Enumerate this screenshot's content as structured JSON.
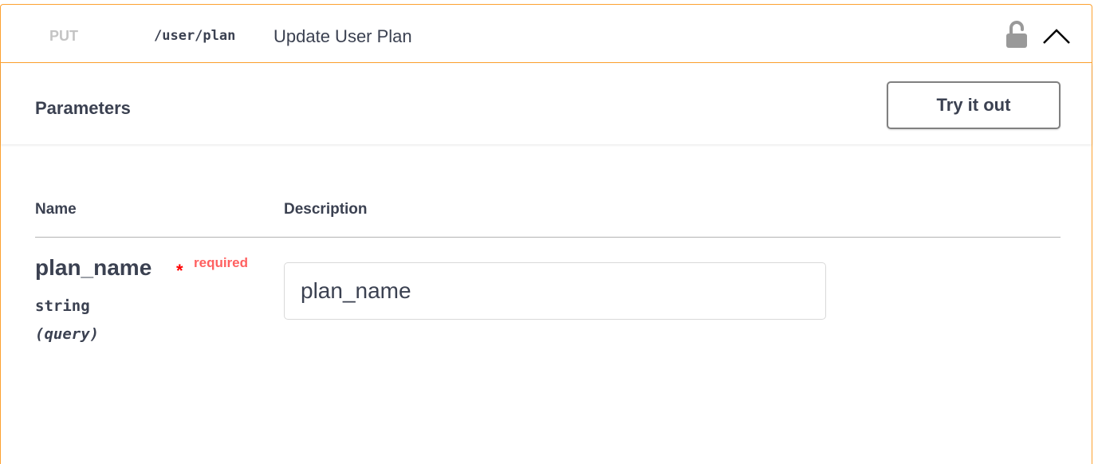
{
  "operation": {
    "method": "PUT",
    "path": "/user/plan",
    "summary": "Update User Plan"
  },
  "icons": {
    "lock": "lock-icon",
    "toggle": "chevron-up-icon"
  },
  "parameters_section": {
    "title": "Parameters",
    "try_button": "Try it out"
  },
  "table": {
    "headers": {
      "name": "Name",
      "description": "Description"
    },
    "params": [
      {
        "name": "plan_name",
        "asterisk": "*",
        "required": "required",
        "type": "string",
        "in": "(query)",
        "placeholder": "plan_name"
      }
    ]
  },
  "colors": {
    "border_accent": "#fca130",
    "required": "#ff0000",
    "text": "#3b4151"
  }
}
